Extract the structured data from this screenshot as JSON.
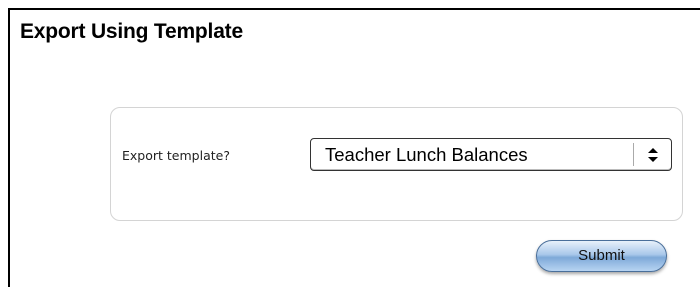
{
  "page": {
    "title": "Export Using Template"
  },
  "form": {
    "template_label": "Export template?",
    "template_selected": "Teacher Lunch Balances",
    "submit_label": "Submit"
  },
  "icons": {
    "select_arrows": "up-down-chevron-icon"
  },
  "colors": {
    "submit_accent": "#a9c8ea",
    "submit_border": "#4a6f9a"
  }
}
